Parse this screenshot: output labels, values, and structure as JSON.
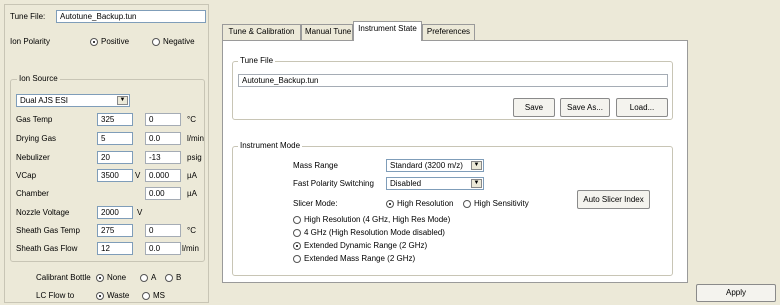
{
  "tune_file": {
    "label": "Tune File:",
    "value": "Autotune_Backup.tun"
  },
  "ion_polarity": {
    "label": "Ion Polarity",
    "options": [
      "Positive",
      "Negative"
    ],
    "selected": "Positive"
  },
  "ion_source": {
    "title": "Ion Source",
    "source_type": "Dual AJS ESI",
    "rows": [
      {
        "label": "Gas Temp",
        "setpoint": "325",
        "actual": "0",
        "unit": "°C"
      },
      {
        "label": "Drying Gas",
        "setpoint": "5",
        "actual": "0.0",
        "unit": "l/min"
      },
      {
        "label": "Nebulizer",
        "setpoint": "20",
        "actual": "-13",
        "unit": "psig"
      },
      {
        "label": "VCap",
        "setpoint": "3500",
        "setpoint_unit": "V",
        "actual": "0.000",
        "unit": "µA"
      },
      {
        "label": "Chamber",
        "actual": "0.00",
        "unit": "µA"
      },
      {
        "label": "Nozzle Voltage",
        "setpoint": "2000",
        "setpoint_unit": "V"
      },
      {
        "label": "Sheath Gas Temp",
        "setpoint": "275",
        "actual": "0",
        "unit": "°C"
      },
      {
        "label": "Sheath Gas Flow",
        "setpoint": "12",
        "actual": "0.0",
        "unit": "l/min"
      }
    ]
  },
  "calibrant_bottle": {
    "label": "Calibrant Bottle",
    "options": [
      "None",
      "A",
      "B"
    ],
    "selected": "None"
  },
  "lc_flow": {
    "label": "LC Flow to",
    "options": [
      "Waste",
      "MS"
    ],
    "selected": "Waste"
  },
  "tabs": [
    {
      "label": "Tune & Calibration",
      "active": false
    },
    {
      "label": "Manual Tune",
      "active": false
    },
    {
      "label": "Instrument State",
      "active": true
    },
    {
      "label": "Preferences",
      "active": false
    }
  ],
  "instrument_state": {
    "tune_file_group": {
      "title": "Tune File",
      "file_name": "Autotune_Backup.tun",
      "save": "Save",
      "save_as": "Save As...",
      "load": "Load..."
    },
    "instrument_mode_group": {
      "title": "Instrument Mode",
      "mass_range_label": "Mass Range",
      "mass_range_value": "Standard (3200 m/z)",
      "fast_polarity_label": "Fast Polarity Switching",
      "fast_polarity_value": "Disabled",
      "slicer_label": "Slicer Mode:",
      "slicer_options": [
        "High Resolution",
        "High Sensitivity"
      ],
      "slicer_selected": "High Resolution",
      "auto_slicer_button": "Auto Slicer Index",
      "modes": [
        {
          "label": "High Resolution (4 GHz, High Res Mode)",
          "selected": false
        },
        {
          "label": "4 GHz (High Resolution Mode disabled)",
          "selected": false
        },
        {
          "label": "Extended Dynamic Range (2 GHz)",
          "selected": true
        },
        {
          "label": "Extended Mass Range (2 GHz)",
          "selected": false
        }
      ]
    }
  },
  "apply_button": "Apply"
}
